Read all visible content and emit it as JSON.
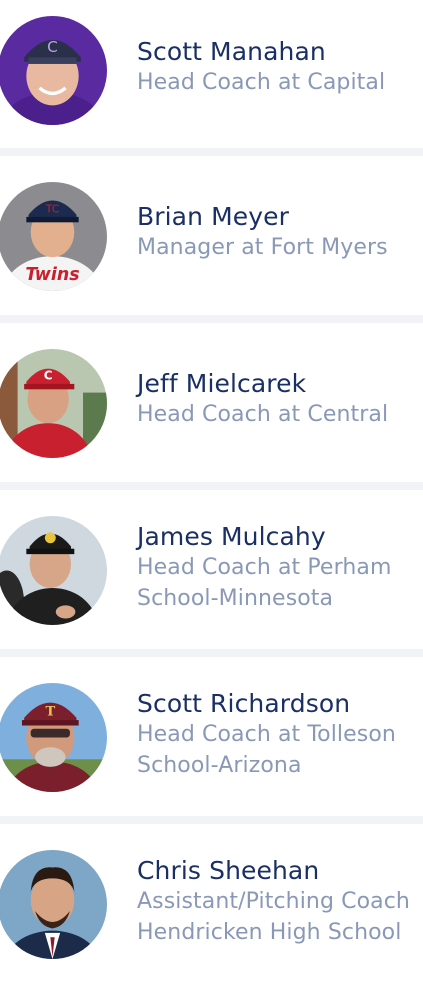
{
  "coaches": [
    {
      "name": "Scott Manahan",
      "role_lines": [
        "Head Coach at Capital"
      ]
    },
    {
      "name": "Brian Meyer",
      "role_lines": [
        "Manager at Fort Myers"
      ]
    },
    {
      "name": "Jeff Mielcarek",
      "role_lines": [
        "Head Coach at Central"
      ]
    },
    {
      "name": "James Mulcahy",
      "role_lines": [
        "Head Coach at Perham",
        "School-Minnesota"
      ]
    },
    {
      "name": "Scott Richardson",
      "role_lines": [
        "Head Coach at Tolleson",
        "School-Arizona"
      ]
    },
    {
      "name": "Chris Sheehan",
      "role_lines": [
        "Assistant/Pitching Coach",
        "Hendricken High School"
      ]
    }
  ],
  "avatars": [
    {
      "icon": "person-photo-icon",
      "cap": "#2a2f4a",
      "logo": "C",
      "shirt": "#4b1f8c",
      "bg": "#5a2aa0",
      "skin": "#e8b9a0"
    },
    {
      "icon": "person-photo-icon",
      "cap": "#1b2a4e",
      "logo": "TC",
      "shirt": "#f4f4f4",
      "bg": "#8c8c90",
      "skin": "#e2b08f"
    },
    {
      "icon": "person-photo-icon",
      "cap": "#c8202e",
      "logo": "C",
      "shirt": "#c8202e",
      "bg": "#b9c7b0",
      "skin": "#d9a184"
    },
    {
      "icon": "person-photo-icon",
      "cap": "#1a1a1a",
      "logo": "",
      "shirt": "#1f1f1f",
      "bg": "#cfd8df",
      "skin": "#d7a689"
    },
    {
      "icon": "person-photo-icon",
      "cap": "#7c1f2c",
      "logo": "T",
      "shirt": "#7c1f2c",
      "bg": "#7fb0dd",
      "skin": "#d19a7c"
    },
    {
      "icon": "person-photo-icon",
      "cap": "",
      "logo": "",
      "shirt": "#1d2b4a",
      "bg": "#7ea6c7",
      "skin": "#d8a486"
    }
  ]
}
